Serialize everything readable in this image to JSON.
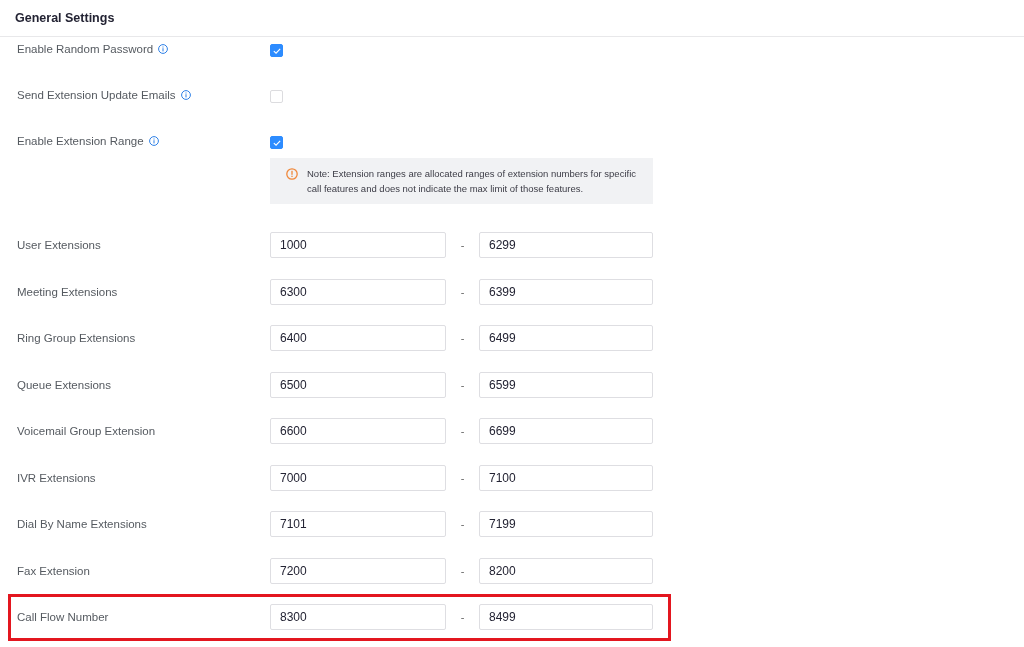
{
  "header": {
    "title": "General Settings"
  },
  "settings": [
    {
      "label": "Enable Random Password",
      "info": true,
      "checked": true
    },
    {
      "label": "Send Extension Update Emails",
      "info": true,
      "checked": false
    },
    {
      "label": "Enable Extension Range",
      "info": true,
      "checked": true,
      "note": "Note: Extension ranges are allocated ranges of extension numbers for specific call features and does not indicate the max limit of those features."
    }
  ],
  "ranges": [
    {
      "label": "User Extensions",
      "from": "1000",
      "separator": "-",
      "to": "6299",
      "highlighted": false
    },
    {
      "label": "Meeting Extensions",
      "from": "6300",
      "separator": "-",
      "to": "6399",
      "highlighted": false
    },
    {
      "label": "Ring Group Extensions",
      "from": "6400",
      "separator": "-",
      "to": "6499",
      "highlighted": false
    },
    {
      "label": "Queue Extensions",
      "from": "6500",
      "separator": "-",
      "to": "6599",
      "highlighted": false
    },
    {
      "label": "Voicemail Group Extension",
      "from": "6600",
      "separator": "-",
      "to": "6699",
      "highlighted": false
    },
    {
      "label": "IVR Extensions",
      "from": "7000",
      "separator": "-",
      "to": "7100",
      "highlighted": false
    },
    {
      "label": "Dial By Name Extensions",
      "from": "7101",
      "separator": "-",
      "to": "7199",
      "highlighted": false
    },
    {
      "label": "Fax Extension",
      "from": "7200",
      "separator": "-",
      "to": "8200",
      "highlighted": false
    },
    {
      "label": "Call Flow Number",
      "from": "8300",
      "separator": "-",
      "to": "8499",
      "highlighted": true
    }
  ]
}
